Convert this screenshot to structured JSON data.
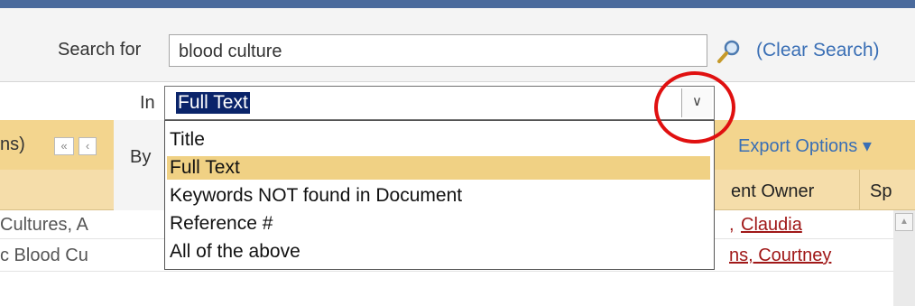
{
  "search": {
    "label": "Search for",
    "value": "blood culture",
    "clear_link": "(Clear Search)",
    "icon": "search-icon"
  },
  "in_field": {
    "label": "In",
    "selected": "Full Text",
    "options": [
      "Title",
      "Full Text",
      "Keywords NOT found in Document",
      "Reference #",
      "All of the above"
    ]
  },
  "by_label": "By",
  "toolbar": {
    "left_text": "ns)",
    "first_btn": "«",
    "prev_btn": "‹",
    "export_options": "Export Options ▾"
  },
  "columns": {
    "owner_header": "ent Owner",
    "next_header": "Sp"
  },
  "rows": [
    {
      "title_fragment": "Cultures, A",
      "owner": "Claudia",
      "owner_prefix": ","
    },
    {
      "title_fragment": "c Blood Cu",
      "owner": "ns, Courtney"
    }
  ],
  "colors": {
    "top_bar": "#4a6a9c",
    "toolbar": "#f3d58e",
    "selected_option": "#f0d184",
    "link": "#3a6fb5",
    "owner_link": "#a01818",
    "annotation_circle": "#e01010"
  }
}
